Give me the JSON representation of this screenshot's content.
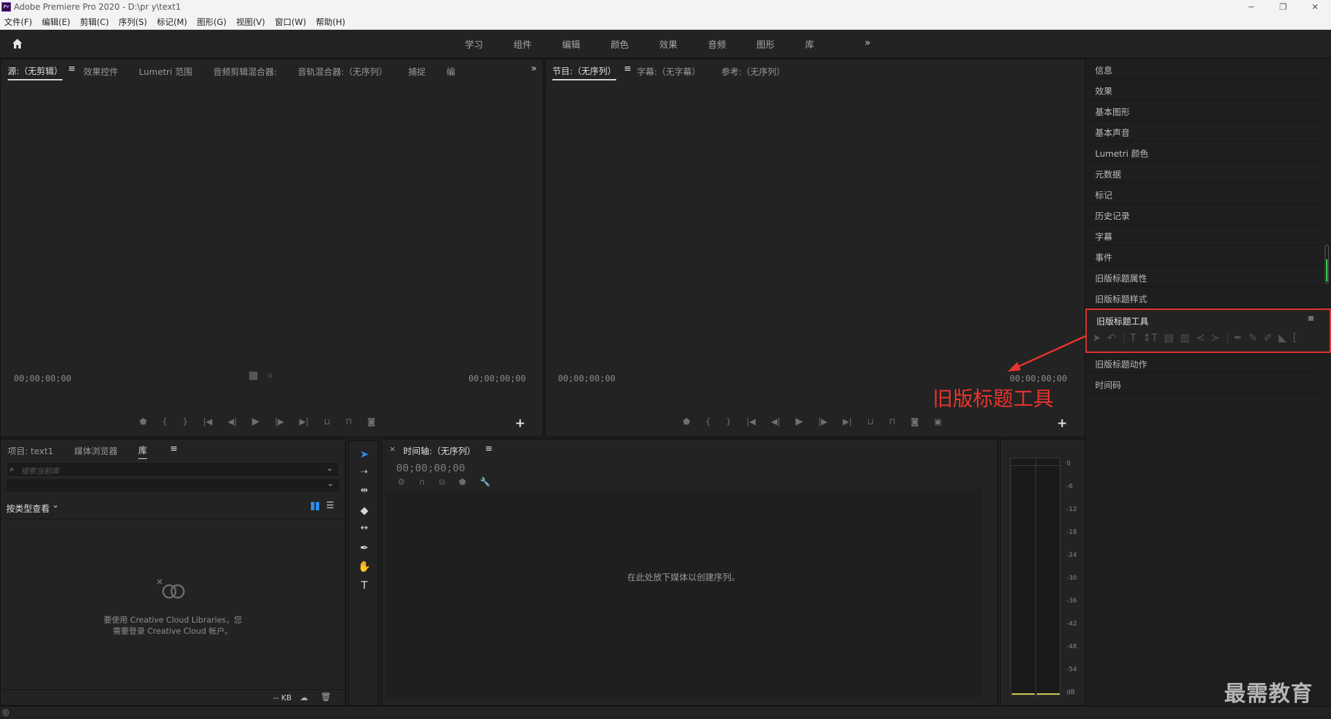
{
  "app": {
    "window_title": "Adobe Premiere Pro 2020 - D:\\pr y\\text1",
    "logo_text": "Pr",
    "win_min": "─",
    "win_restore": "❐",
    "win_close": "✕"
  },
  "menu": [
    "文件(F)",
    "编辑(E)",
    "剪辑(C)",
    "序列(S)",
    "标记(M)",
    "图形(G)",
    "视图(V)",
    "窗口(W)",
    "帮助(H)"
  ],
  "workspaces": [
    "学习",
    "组件",
    "编辑",
    "颜色",
    "效果",
    "音频",
    "图形",
    "库"
  ],
  "workspace_more": "»",
  "source_panel": {
    "tabs": [
      "源:（无剪辑）",
      "效果控件",
      "Lumetri 范围",
      "音频剪辑混合器:",
      "音轨混合器:（无序列）",
      "捕捉",
      "编"
    ],
    "menu_icon": "≡",
    "more": "»",
    "timecode_left": "00;00;00;00",
    "timecode_right": "00;00;00;00"
  },
  "program_panel": {
    "tabs": [
      "节目:（无序列）",
      "字幕:（无字幕）",
      "参考:（无序列）"
    ],
    "menu_icon": "≡",
    "timecode_left": "00;00;00;00",
    "timecode_right": "00;00;00;00"
  },
  "right_panel": {
    "items": [
      "信息",
      "效果",
      "基本图形",
      "基本声音",
      "Lumetri 颜色",
      "元数据",
      "标记",
      "历史记录",
      "字幕",
      "事件",
      "旧版标题属性",
      "旧版标题样式"
    ],
    "highlight_title": "旧版标题工具",
    "highlight_menu": "≡",
    "items_after": [
      "旧版标题动作",
      "时间码"
    ]
  },
  "annotation": {
    "label": "旧版标题工具",
    "color": "#e8342e"
  },
  "project_panel": {
    "tabs": [
      "项目: text1",
      "媒体浏览器",
      "库"
    ],
    "menu_icon": "≡",
    "search_placeholder": "搜索当前库",
    "view_by": "按类型查看",
    "cc_message_line1": "要使用 Creative Cloud Libraries，您",
    "cc_message_line2": "需要登录 Creative Cloud 帐户。",
    "footer_kb": "-- KB"
  },
  "timeline_panel": {
    "title": "时间轴:（无序列）",
    "close": "×",
    "menu_icon": "≡",
    "timecode": "00;00;00;00",
    "empty_message": "在此处放下媒体以创建序列。"
  },
  "audio_meter": {
    "scale": [
      "0",
      "-6",
      "-12",
      "-18",
      "-24",
      "-30",
      "-36",
      "-42",
      "-48",
      "-54",
      "dB"
    ]
  },
  "watermark": "最需教育",
  "colors": {
    "accent_blue": "#2d8ceb",
    "annotation_red": "#e8342e",
    "meter_green": "#3ddc5a"
  }
}
